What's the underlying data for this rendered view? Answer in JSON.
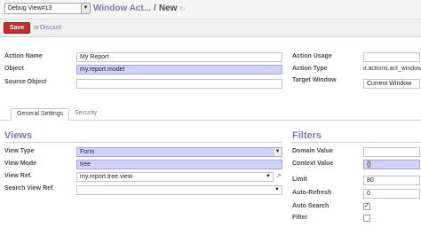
{
  "topbar": {
    "debug_select": "Debug View#13",
    "breadcrumb_parent": "Window Act...",
    "breadcrumb_sep": "/",
    "breadcrumb_current": "New",
    "refresh_icon": "↻"
  },
  "actionbar": {
    "save_label": "Save",
    "or_text": "or",
    "discard_label": "Discard"
  },
  "form": {
    "left": {
      "action_name_label": "Action Name",
      "action_name_value": "My Report",
      "object_label": "Object",
      "object_value": "my.report.model",
      "source_object_label": "Source Object",
      "source_object_value": ""
    },
    "right": {
      "action_usage_label": "Action Usage",
      "action_usage_value": "",
      "action_type_label": "Action Type",
      "action_type_value": "ir.actions.act_window",
      "target_window_label": "Target Window",
      "target_window_value": "Current Window"
    }
  },
  "tabs": [
    {
      "label": "General Settings",
      "active": true
    },
    {
      "label": "Security",
      "active": false
    }
  ],
  "views": {
    "title": "Views",
    "view_type_label": "View Type",
    "view_type_value": "Form",
    "view_mode_label": "View Mode",
    "view_mode_value": "tree",
    "view_ref_label": "View Ref.",
    "view_ref_value": "my.report.tree.view",
    "search_view_ref_label": "Search View Ref.",
    "search_view_ref_value": ""
  },
  "filters": {
    "title": "Filters",
    "domain_value_label": "Domain Value",
    "domain_value_value": "",
    "context_value_label": "Context Value",
    "context_value_value": "{}",
    "limit_label": "Limit",
    "limit_value": "80",
    "auto_refresh_label": "Auto-Refresh",
    "auto_refresh_value": "0",
    "auto_search_label": "Auto Search",
    "auto_search_checked": true,
    "auto_search_mark": "✓",
    "filter_label": "Filter",
    "filter_checked": false
  },
  "colors": {
    "accent": "#7c7bad",
    "required_field": "#d2d2ff",
    "save_button": "#c92a2a"
  }
}
